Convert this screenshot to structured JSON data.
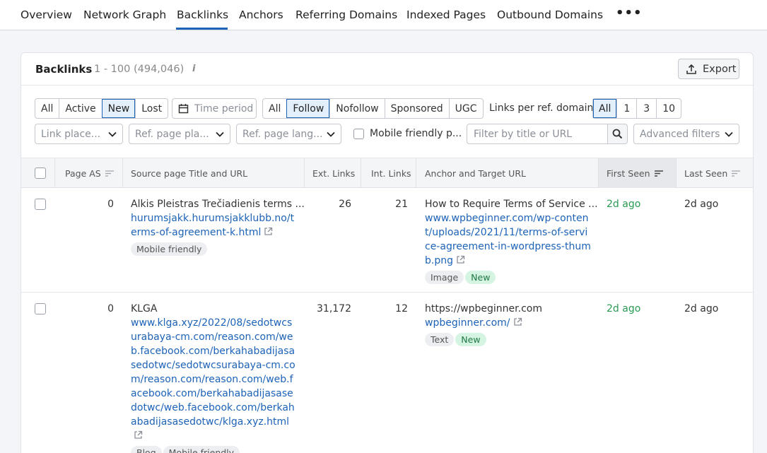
{
  "nav": {
    "tabs": [
      "Overview",
      "Network Graph",
      "Backlinks",
      "Anchors",
      "Referring Domains",
      "Indexed Pages",
      "Outbound Domains"
    ],
    "active": "Backlinks",
    "more": "•••"
  },
  "card": {
    "title": "Backlinks",
    "count": "1 - 100 (494,046)",
    "info": "i",
    "export_label": "Export"
  },
  "filters": {
    "status": [
      "All",
      "Active",
      "New",
      "Lost"
    ],
    "status_selected": "New",
    "time_period": "Time period",
    "follow": [
      "All",
      "Follow",
      "Nofollow",
      "Sponsored",
      "UGC"
    ],
    "follow_selected": "Follow",
    "links_per_domain_label": "Links per ref. domain",
    "links_per_domain": [
      "All",
      "1",
      "3",
      "10"
    ],
    "links_per_domain_selected": "All",
    "link_placement": "Link place...",
    "ref_page_placement": "Ref. page pla...",
    "ref_page_language": "Ref. page lang...",
    "mobile_friendly": "Mobile friendly p...",
    "search_placeholder": "Filter by title or URL",
    "advanced": "Advanced filters"
  },
  "table": {
    "headers": {
      "page_as": "Page AS",
      "source": "Source page Title and URL",
      "ext_links": "Ext. Links",
      "int_links": "Int. Links",
      "anchor": "Anchor and Target URL",
      "first_seen": "First Seen",
      "last_seen": "Last Seen"
    },
    "rows": [
      {
        "page_as": "0",
        "source_title": "Alkis Pleistras Trečiadienis terms ...",
        "source_url": "hurumsjakk.hurumsjakklubb.no/terms-of-agreement-k.html",
        "source_tags": [
          "Mobile friendly"
        ],
        "ext_links": "26",
        "int_links": "21",
        "anchor_text": "How to Require Terms of Service ...",
        "target_url": "www.wpbeginner.com/wp-content/uploads/2021/11/terms-of-service-agreement-in-wordpress-thumb.png",
        "anchor_tags": [
          "Image",
          "New"
        ],
        "first_seen": "2d ago",
        "last_seen": "2d ago"
      },
      {
        "page_as": "0",
        "source_title": "KLGA",
        "source_url": "www.klga.xyz/2022/08/sedotwcsurabaya-cm.com/reason.com/web.facebook.com/berkahabadijasasedotwc/sedotwcsurabaya-cm.com/reason.com/reason.com/web.facebook.com/berkahabadijasasedotwc/web.facebook.com/berkahabadijasasedotwc/klga.xyz.html",
        "source_tags": [
          "Blog",
          "Mobile friendly"
        ],
        "ext_links": "31,172",
        "int_links": "12",
        "anchor_text": "https://wpbeginner.com",
        "target_url": "wpbeginner.com/",
        "anchor_tags": [
          "Text",
          "New"
        ],
        "first_seen": "2d ago",
        "last_seen": "2d ago"
      }
    ]
  },
  "colors": {
    "accent": "#1d63b8",
    "green": "#2a9a52"
  }
}
